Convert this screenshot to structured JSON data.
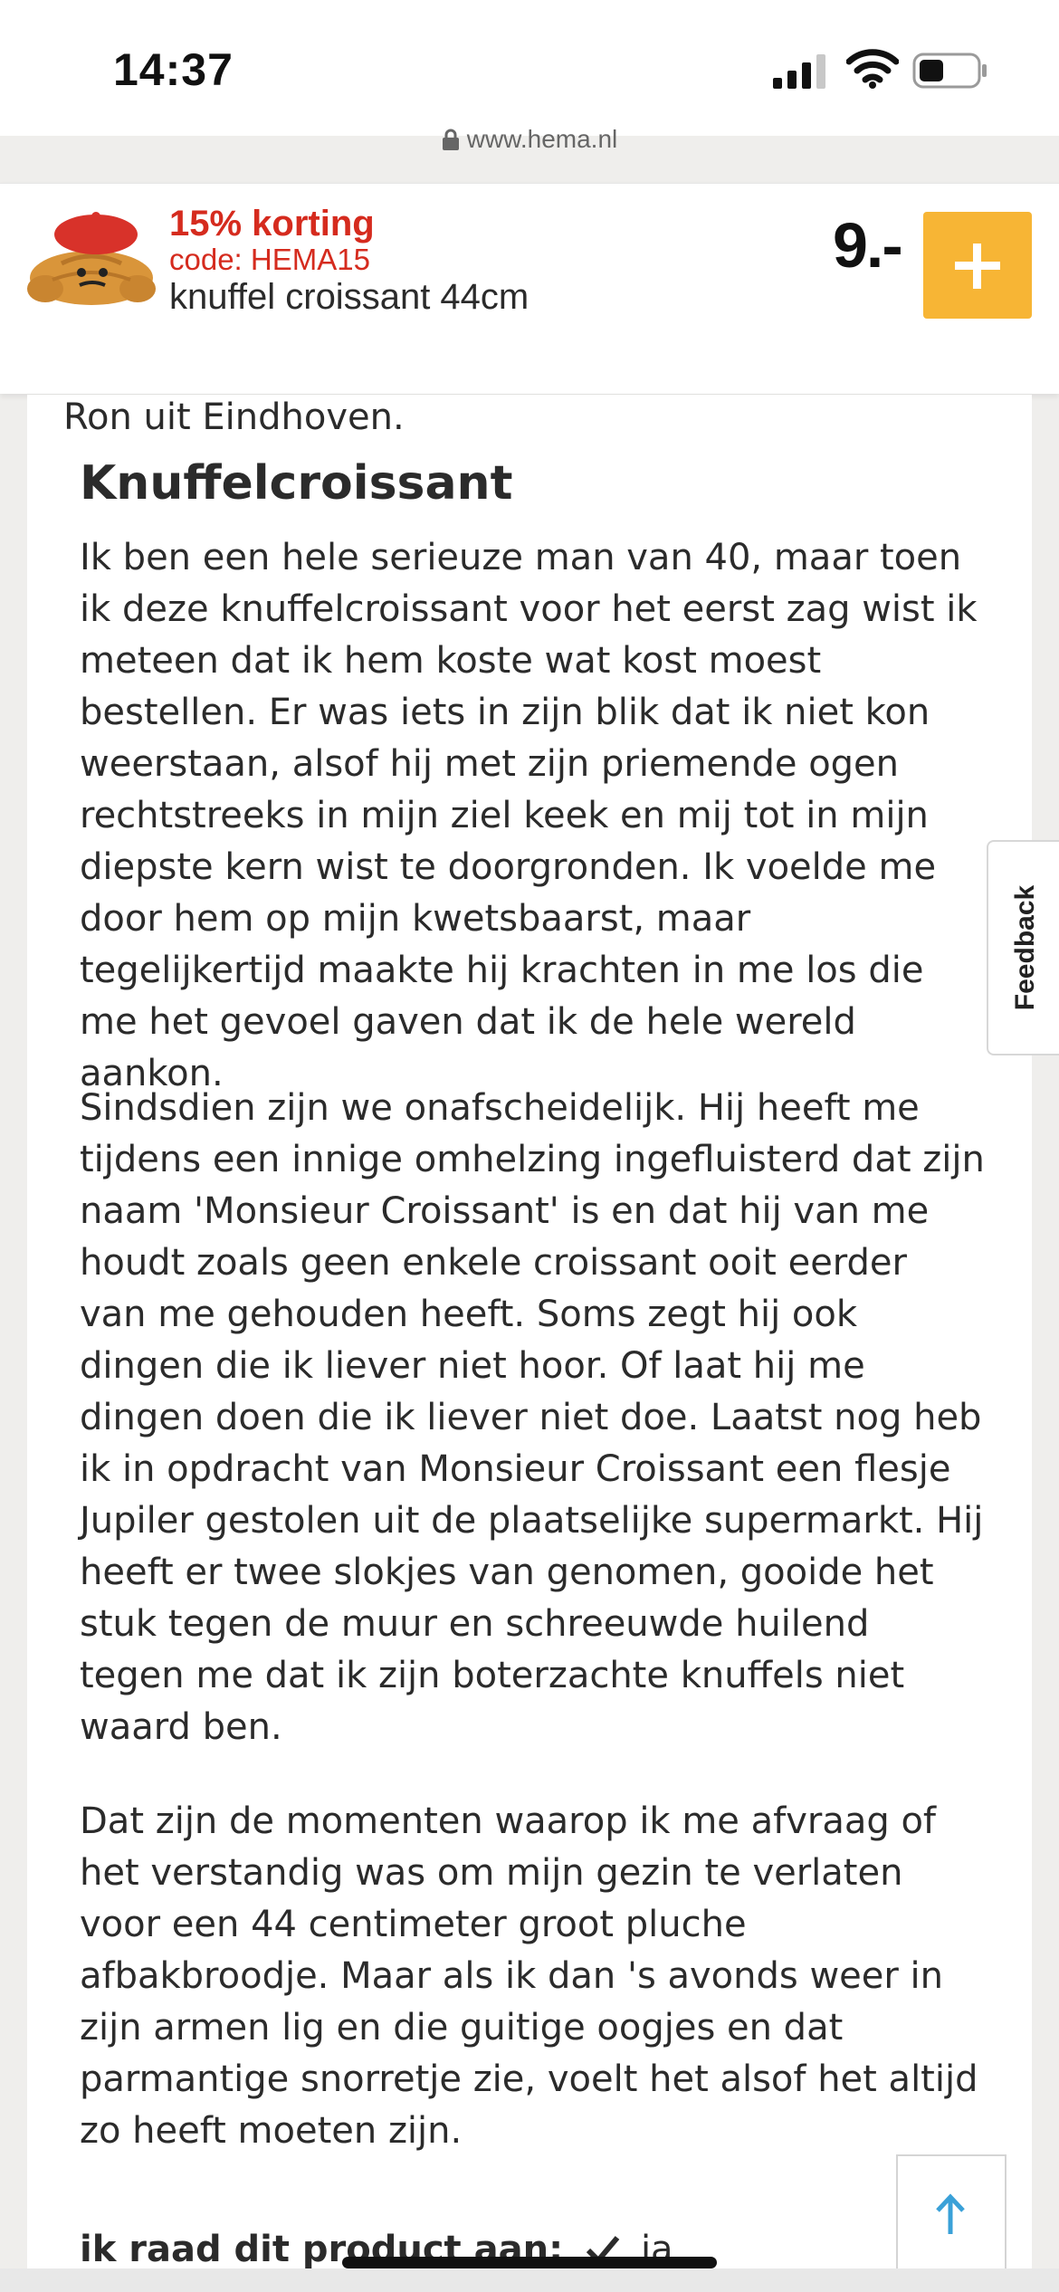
{
  "status_bar": {
    "time": "14:37",
    "url": "www.hema.nl"
  },
  "product": {
    "discount": "15% korting",
    "code": "code: HEMA15",
    "name": "knuffel croissant 44cm",
    "price": "9.-",
    "add_label": "+",
    "colors": {
      "discount": "#d52b1e",
      "add_button": "#f7b535"
    }
  },
  "review": {
    "author": "Ron uit Eindhoven.",
    "title": "Knuffelcroissant",
    "paragraphs": [
      "Ik ben een hele serieuze man van 40, maar toen ik deze knuffelcroissant voor het eerst zag wist ik meteen dat ik hem koste wat kost moest bestellen. Er was iets in zijn blik dat ik niet kon weerstaan, alsof hij met zijn priemende ogen rechtstreeks in mijn ziel keek en mij tot in mijn diepste kern wist te doorgronden. Ik voelde me door hem op mijn kwetsbaarst, maar tegelijkertijd maakte hij krachten in me los die me het gevoel gaven dat ik de hele wereld aankon.",
      "Sindsdien zijn we onafscheidelijk. Hij heeft me tijdens een innige omhelzing ingefluisterd dat zijn naam 'Monsieur Croissant' is en dat hij van me houdt zoals geen enkele croissant ooit eerder van me gehouden heeft. Soms zegt hij ook dingen die ik liever niet hoor. Of laat hij me dingen doen die ik liever niet doe. Laatst nog heb ik in opdracht van Monsieur Croissant een flesje Jupiler gestolen uit de plaatselijke supermarkt. Hij heeft er twee slokjes van genomen, gooide het stuk tegen de muur en schreeuwde huilend tegen me dat ik zijn boterzachte knuffels niet waard ben.",
      "Dat zijn de momenten waarop ik me afvraag of het verstandig was om mijn gezin te verlaten voor een 44 centimeter groot pluche afbakbroodje. Maar als ik dan 's avonds weer in zijn armen lig en die guitige oogjes en dat parmantige snorretje zie, voelt het alsof het altijd zo heeft moeten zijn."
    ],
    "recommend_label": "ik raad dit product aan:",
    "recommend_answer": "ja"
  },
  "feedback_label": "Feedback",
  "icons": {
    "lock": "lock-icon",
    "signal": "cellular-signal-icon",
    "wifi": "wifi-icon",
    "battery": "battery-icon",
    "scroll_top": "arrow-up-icon",
    "check": "checkmark-icon"
  }
}
